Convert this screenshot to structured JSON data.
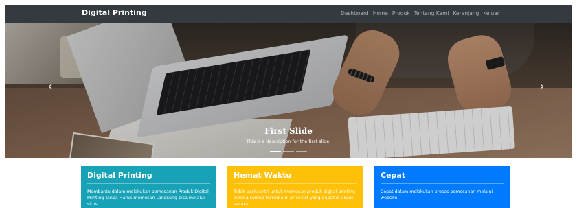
{
  "navbar": {
    "brand": "Digital Printing",
    "links": [
      "Dashboard",
      "Home",
      "Produk",
      "Tentang Kami",
      "Keranjang",
      "Keluar"
    ]
  },
  "carousel": {
    "prev_icon": "chevron-left-icon",
    "next_icon": "chevron-right-icon",
    "prev_glyph": "‹",
    "next_glyph": "›",
    "slide_title": "First Slide",
    "slide_text": "This is a description for the first slide."
  },
  "cards": [
    {
      "title": "Digital Printing",
      "text": "Membantu dalam melakukan pemesanan Produk Digital Printing Tanpa Harus memesan Langsung bisa melalui situs",
      "color": "#17a2b8"
    },
    {
      "title": "Hemat Waktu",
      "text": "Tidak perlu antri untuk memesan produk digital printing karena semua tersedia di price list yang dapat di akses secara",
      "color": "#ffc107"
    },
    {
      "title": "Cepat",
      "text": "Cepat dalam melakukan proses pemesanan melalui website",
      "color": "#007bff"
    }
  ]
}
